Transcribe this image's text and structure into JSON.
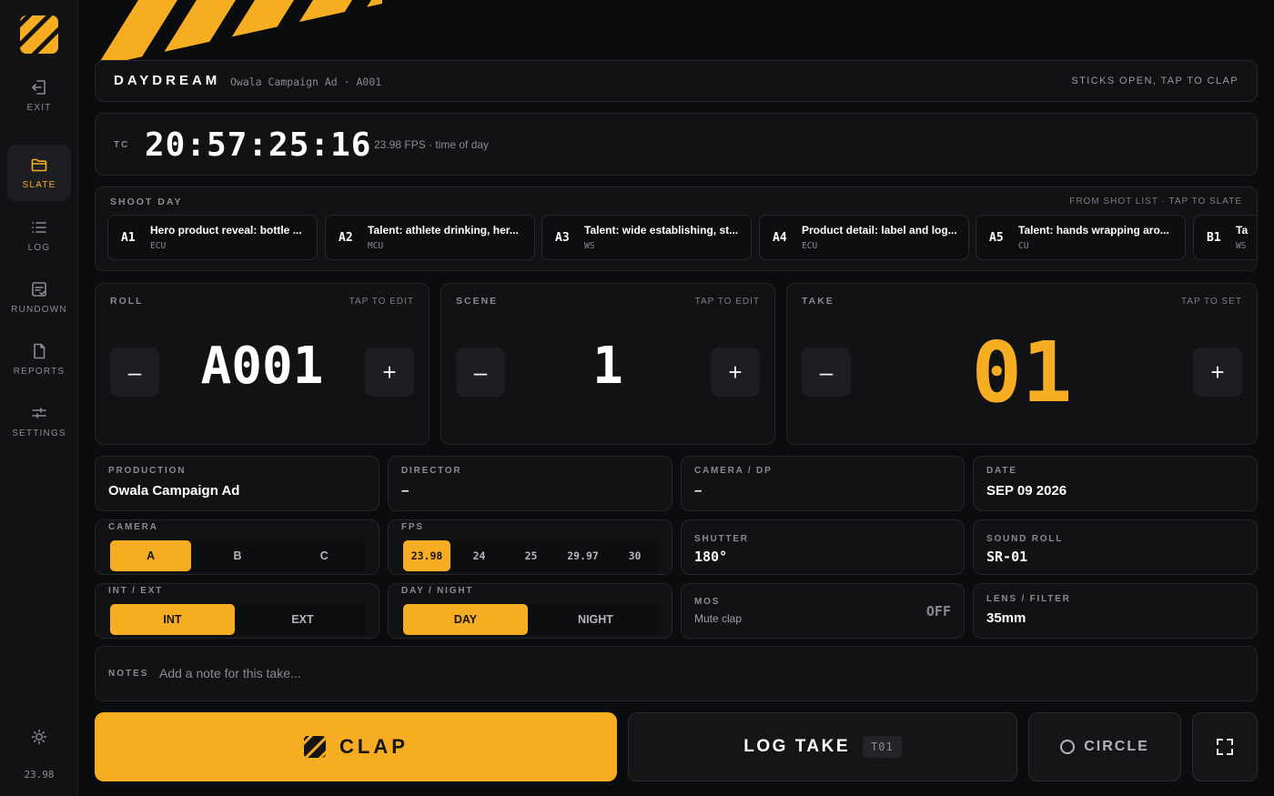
{
  "sidebar": {
    "items": [
      {
        "label": "EXIT",
        "icon": "exit-icon"
      },
      {
        "label": "SLATE",
        "icon": "folder-icon",
        "active": true
      },
      {
        "label": "LOG",
        "icon": "list-icon"
      },
      {
        "label": "RUNDOWN",
        "icon": "rundown-icon"
      },
      {
        "label": "REPORTS",
        "icon": "file-icon"
      },
      {
        "label": "SETTINGS",
        "icon": "sliders-icon"
      }
    ],
    "theme_icon": "sun-icon",
    "fps": "23.98"
  },
  "header": {
    "brand": "DAYDREAM",
    "breadcrumb": "Owala Campaign Ad · A001",
    "hint": "STICKS OPEN, TAP TO CLAP"
  },
  "timecode": {
    "label": "TC",
    "value": "20:57:25:16",
    "meta": "23.98 FPS · time of day"
  },
  "shoot_day": {
    "label": "SHOOT DAY",
    "hint": "FROM SHOT LIST · TAP TO SLATE",
    "shots": [
      {
        "code": "A1",
        "title": "Hero product reveal: bottle ...",
        "type": "ECU"
      },
      {
        "code": "A2",
        "title": "Talent: athlete drinking, her...",
        "type": "MCU"
      },
      {
        "code": "A3",
        "title": "Talent: wide establishing, st...",
        "type": "WS"
      },
      {
        "code": "A4",
        "title": "Product detail: label and log...",
        "type": "ECU"
      },
      {
        "code": "A5",
        "title": "Talent: hands wrapping aro...",
        "type": "CU"
      },
      {
        "code": "B1",
        "title": "Ta",
        "type": "WS"
      }
    ]
  },
  "roll": {
    "label": "ROLL",
    "hint": "TAP TO EDIT",
    "value": "A001",
    "minus": "–",
    "plus": "+"
  },
  "scene": {
    "label": "SCENE",
    "hint": "TAP TO EDIT",
    "value": "1",
    "minus": "–",
    "plus": "+"
  },
  "take": {
    "label": "TAKE",
    "hint": "TAP TO SET",
    "value": "01",
    "minus": "–",
    "plus": "+"
  },
  "fields": {
    "production": {
      "label": "PRODUCTION",
      "value": "Owala Campaign Ad"
    },
    "director": {
      "label": "DIRECTOR",
      "value": "–"
    },
    "camera_dp": {
      "label": "CAMERA / DP",
      "value": "–"
    },
    "date": {
      "label": "DATE",
      "value": "SEP 09 2026"
    },
    "shutter": {
      "label": "SHUTTER",
      "value": "180°"
    },
    "sound_roll": {
      "label": "SOUND ROLL",
      "value": "SR-01"
    },
    "lens_filter": {
      "label": "LENS / FILTER",
      "value": "35mm"
    },
    "mos": {
      "label": "MOS",
      "sub": "Mute clap",
      "state": "OFF"
    }
  },
  "camera": {
    "label": "CAMERA",
    "options": [
      "A",
      "B",
      "C"
    ],
    "selected": "A"
  },
  "fps": {
    "label": "FPS",
    "options": [
      "23.98",
      "24",
      "25",
      "29.97",
      "30"
    ],
    "selected": "23.98"
  },
  "int_ext": {
    "label": "INT / EXT",
    "options": [
      "INT",
      "EXT"
    ],
    "selected": "INT"
  },
  "day_night": {
    "label": "DAY / NIGHT",
    "options": [
      "DAY",
      "NIGHT"
    ],
    "selected": "DAY"
  },
  "notes": {
    "label": "NOTES",
    "placeholder": "Add a note for this take..."
  },
  "actions": {
    "clap": "CLAP",
    "log_take": "LOG TAKE",
    "take_badge": "T01",
    "circle": "CIRCLE",
    "fullscreen_icon": "fullscreen-icon"
  },
  "colors": {
    "accent": "#f7ad22",
    "background": "#0b0c0e",
    "panel": "#111214"
  }
}
